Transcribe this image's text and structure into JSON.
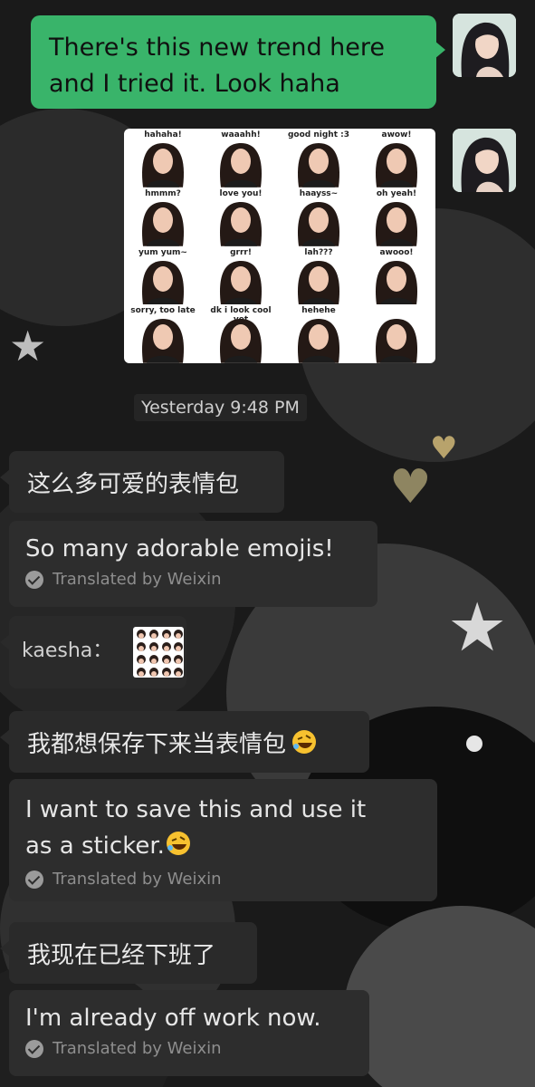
{
  "messages": {
    "outgoing_text": "There's this new trend here and I tried it. Look haha",
    "sticker_labels": [
      "hahaha!",
      "waaahh!",
      "good night :3",
      "awow!",
      "hmmm?",
      "love you!",
      "haayss~",
      "oh yeah!",
      "yum yum~",
      "grrr!",
      "lah???",
      "awooo!",
      "sorry, too late",
      "dk i look cool yet",
      "hehehe",
      ""
    ],
    "timestamp": "Yesterday 9:48 PM",
    "incoming": [
      {
        "text": "这么多可爱的表情包"
      },
      {
        "text": "So many adorable emojis!",
        "translated": "Translated by Weixin"
      },
      {
        "text": "kaesha："
      },
      {
        "text": "我都想保存下来当表情包"
      },
      {
        "text_line1": "I want to save this and use it",
        "text_line2": "as a sticker.",
        "translated": "Translated by Weixin"
      },
      {
        "text": "我现在已经下班了"
      },
      {
        "text": "I'm already off work now.",
        "translated": "Translated by Weixin"
      }
    ]
  },
  "icons": {
    "avatar": "anime-woman-avatar",
    "emoji": "rofl-emoji",
    "check": "check-circle-icon"
  },
  "colors": {
    "outgoing_bubble": "#39b46a",
    "incoming_bubble": "#2a2a2a",
    "background": "#1a1a1a"
  }
}
